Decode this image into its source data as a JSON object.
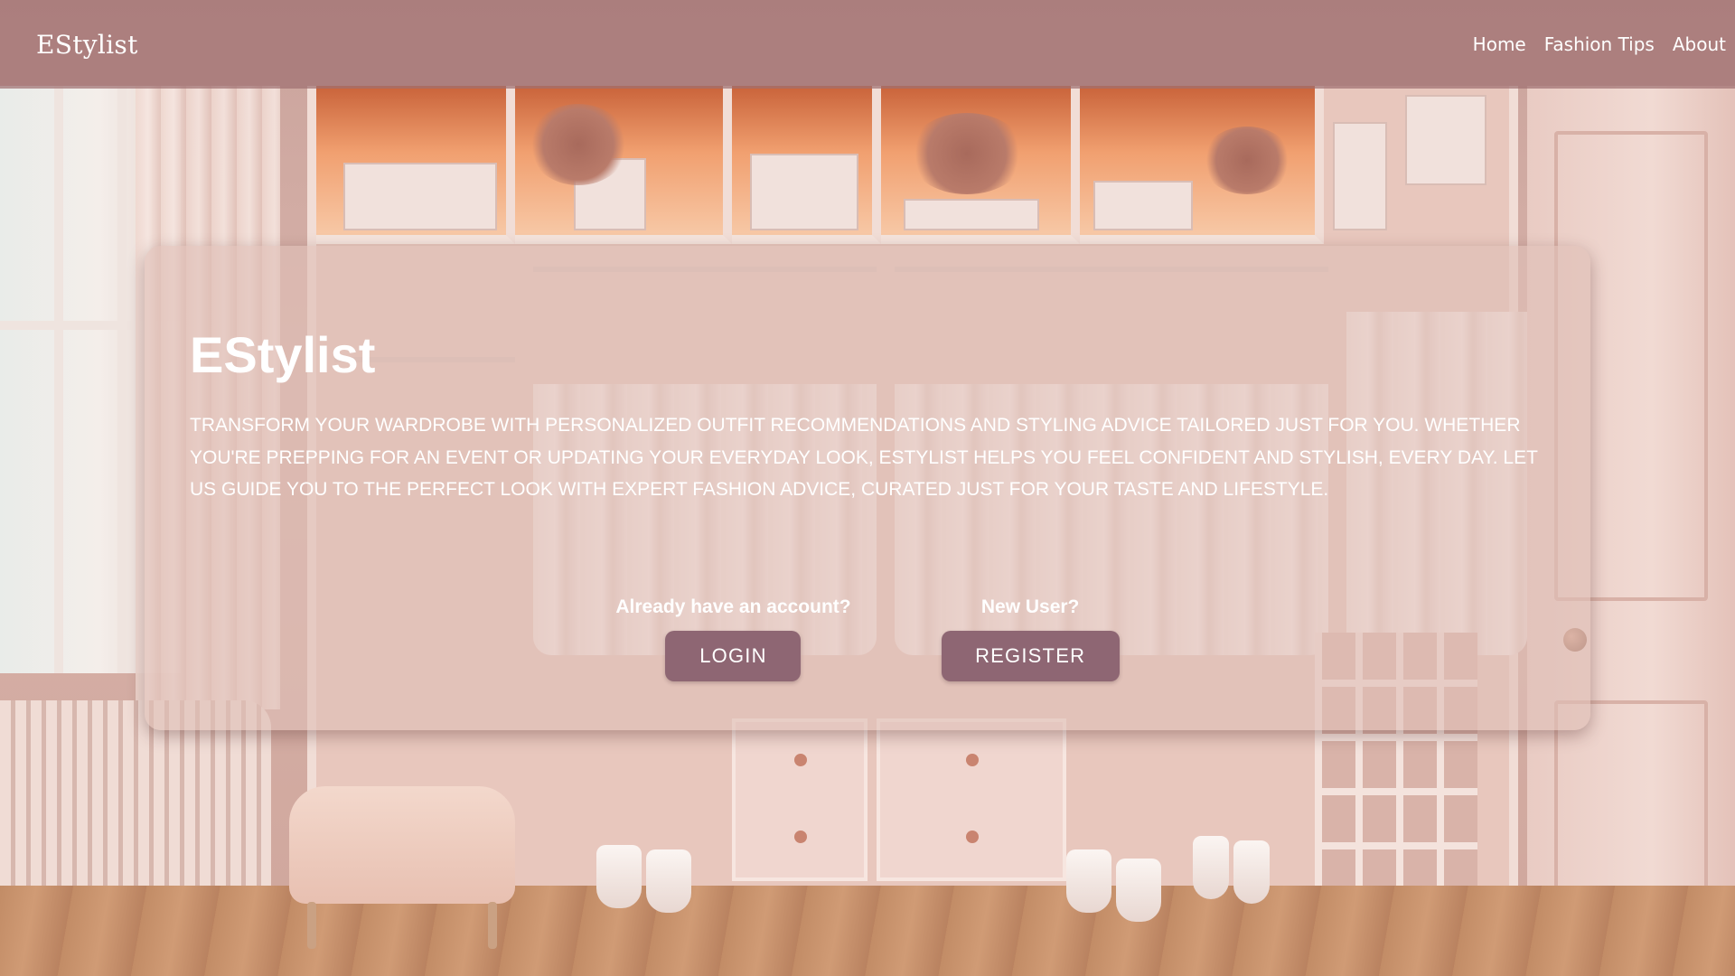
{
  "colors": {
    "navbar": "#a07072",
    "button": "#8e6673",
    "text": "#ffffff"
  },
  "navbar": {
    "brand": "EStylist",
    "links": [
      {
        "label": "Home"
      },
      {
        "label": "Fashion Tips"
      },
      {
        "label": "About"
      }
    ]
  },
  "hero": {
    "title": "EStylist",
    "description": "Transform your wardrobe with personalized outfit recommendations and styling advice tailored just for you. Whether you're prepping for an event or updating your everyday look, EStylist helps you feel confident and stylish, every day. Let us guide you to the perfect look with expert fashion advice, curated just for your taste and lifestyle."
  },
  "auth": {
    "login_prompt": "Already have an account?",
    "login_label": "LOGIN",
    "register_prompt": "New User?",
    "register_label": "REGISTER"
  }
}
